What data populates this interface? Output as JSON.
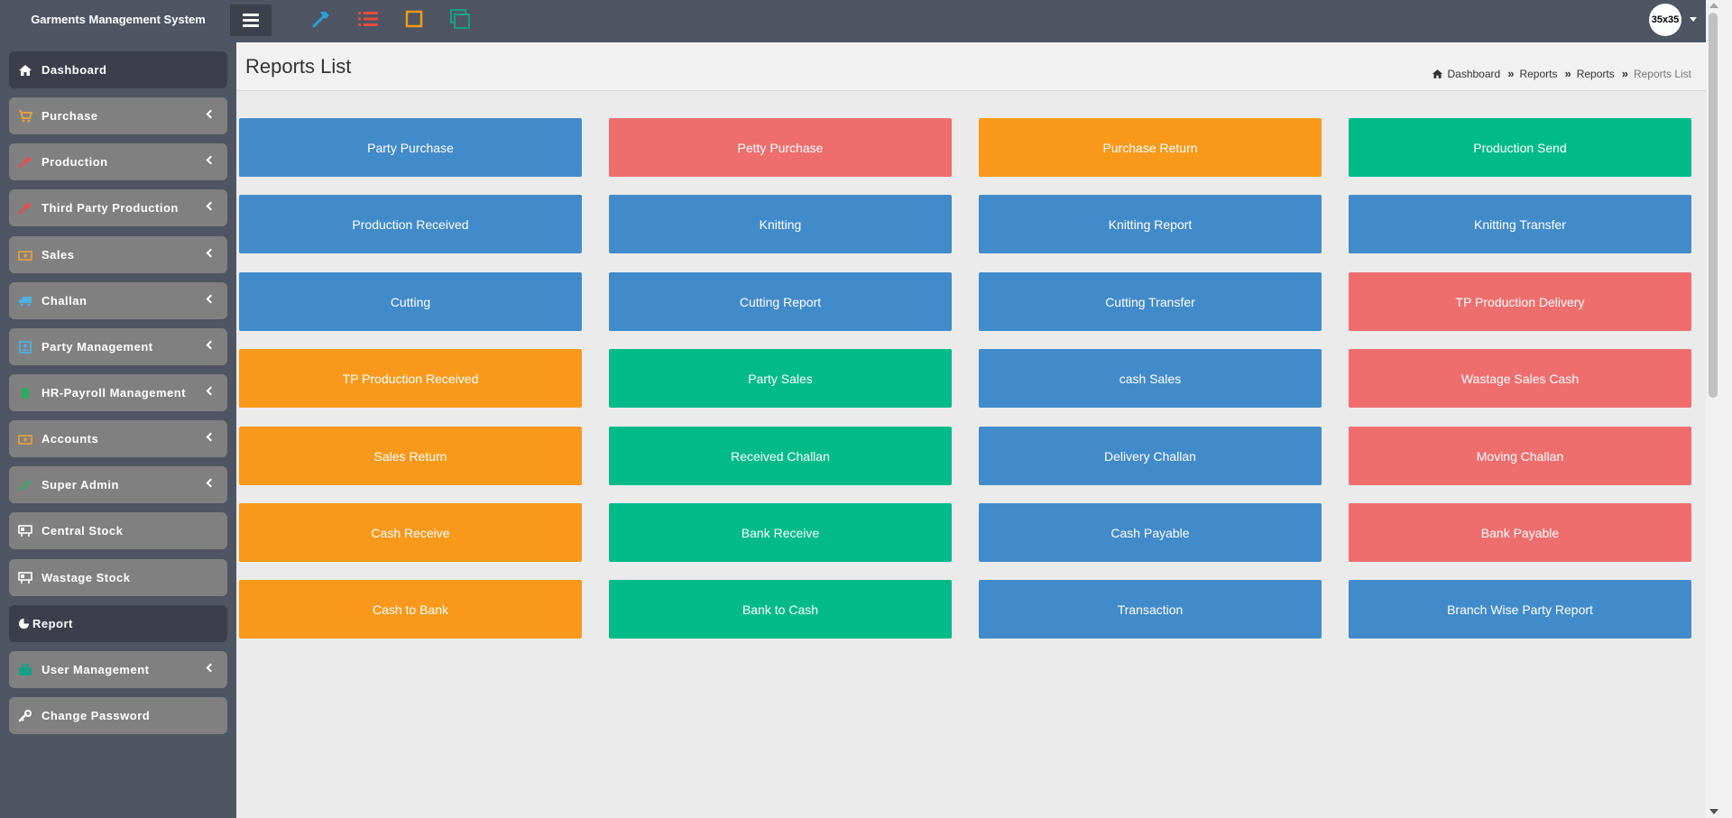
{
  "app": {
    "title": "Garments Management System"
  },
  "topbar": {
    "icons": [
      "hammer-icon",
      "list-icon",
      "square-icon",
      "windows-icon"
    ],
    "avatar_text": "35x35"
  },
  "sidebar": {
    "items": [
      {
        "label": "Dashboard",
        "icon": "home-icon",
        "active": true,
        "has_children": false
      },
      {
        "label": "Purchase",
        "icon": "cart-icon",
        "has_children": true
      },
      {
        "label": "Production",
        "icon": "tool-icon",
        "has_children": true
      },
      {
        "label": "Third Party Production",
        "icon": "tool-icon",
        "has_children": true
      },
      {
        "label": "Sales",
        "icon": "money-icon",
        "has_children": true
      },
      {
        "label": "Challan",
        "icon": "truck-icon",
        "has_children": true
      },
      {
        "label": "Party Management",
        "icon": "contact-icon",
        "has_children": true
      },
      {
        "label": "HR-Payroll Management",
        "icon": "dollar-icon",
        "has_children": true
      },
      {
        "label": "Accounts",
        "icon": "money-icon",
        "has_children": true
      },
      {
        "label": "Super Admin",
        "icon": "pencil-icon",
        "has_children": true
      },
      {
        "label": "Central Stock",
        "icon": "desk-icon",
        "has_children": false
      },
      {
        "label": "Wastage Stock",
        "icon": "desk-icon",
        "has_children": false
      },
      {
        "label": "Report",
        "icon": "pie-chart-icon",
        "active": true,
        "has_children": false
      },
      {
        "label": "User Management",
        "icon": "briefcase-icon",
        "has_children": true
      },
      {
        "label": "Change Password",
        "icon": "key-icon",
        "has_children": false
      }
    ]
  },
  "header": {
    "title": "Reports List",
    "breadcrumb": [
      "Dashboard",
      "Reports",
      "Reports",
      "Reports List"
    ]
  },
  "tiles": [
    {
      "label": "Party Purchase",
      "color": "blue"
    },
    {
      "label": "Petty Purchase",
      "color": "red"
    },
    {
      "label": "Purchase Return",
      "color": "orange"
    },
    {
      "label": "Production Send",
      "color": "green"
    },
    {
      "label": "Production Received",
      "color": "blue"
    },
    {
      "label": "Knitting",
      "color": "blue"
    },
    {
      "label": "Knitting Report",
      "color": "blue"
    },
    {
      "label": "Knitting Transfer",
      "color": "blue"
    },
    {
      "label": "Cutting",
      "color": "blue"
    },
    {
      "label": "Cutting Report",
      "color": "blue"
    },
    {
      "label": "Cutting Transfer",
      "color": "blue"
    },
    {
      "label": "TP Production Delivery",
      "color": "red"
    },
    {
      "label": "TP Production Received",
      "color": "orange"
    },
    {
      "label": "Party Sales",
      "color": "green"
    },
    {
      "label": "cash Sales",
      "color": "blue"
    },
    {
      "label": "Wastage Sales Cash",
      "color": "red"
    },
    {
      "label": "Sales Return",
      "color": "orange"
    },
    {
      "label": "Received Challan",
      "color": "green"
    },
    {
      "label": "Delivery Challan",
      "color": "blue"
    },
    {
      "label": "Moving Challan",
      "color": "red"
    },
    {
      "label": "Cash Receive",
      "color": "orange"
    },
    {
      "label": "Bank Receive",
      "color": "green"
    },
    {
      "label": "Cash Payable",
      "color": "blue"
    },
    {
      "label": "Bank Payable",
      "color": "red"
    },
    {
      "label": "Cash to Bank",
      "color": "orange"
    },
    {
      "label": "Bank to Cash",
      "color": "green"
    },
    {
      "label": "Transaction",
      "color": "blue"
    },
    {
      "label": "Branch Wise Party Report",
      "color": "blue"
    }
  ],
  "colors": {
    "blue": "#428bca",
    "red": "#ee6e6e",
    "orange": "#f8991c",
    "green": "#00bb88",
    "sidebar_bg": "#4f5562"
  }
}
